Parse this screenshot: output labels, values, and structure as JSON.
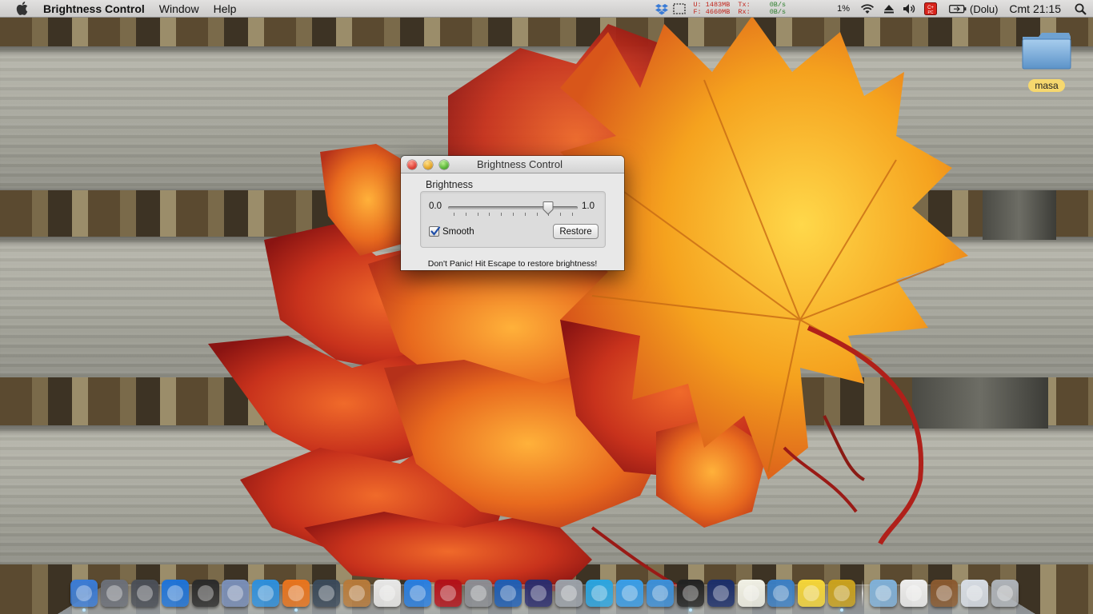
{
  "menubar": {
    "app_name": "Brightness Control",
    "menus": [
      "Window",
      "Help"
    ],
    "status": {
      "mem_used": "U: 1483MB",
      "mem_free": "F: 4660MB",
      "tx_label": "Tx:",
      "rx_label": "Rx:",
      "tx_rate": "0B/s",
      "rx_rate": "0B/s",
      "cpu": "1%",
      "battery": "(Dolu)",
      "clock": "Cmt 21:15"
    }
  },
  "desktop": {
    "folder_label": "masa"
  },
  "window": {
    "title": "Brightness Control",
    "group_label": "Brightness",
    "slider_min": "0.0",
    "slider_max": "1.0",
    "slider_value": 0.8,
    "smooth_label": "Smooth",
    "smooth_checked": true,
    "restore_label": "Restore",
    "hint": "Don't Panic!  Hit Escape to restore brightness!"
  },
  "dock": {
    "items": [
      {
        "name": "finder",
        "icon": "finder-icon",
        "color": "#3a7bd5",
        "running": true
      },
      {
        "name": "launchpad",
        "icon": "rocket-icon",
        "color": "#6b6f78",
        "running": false
      },
      {
        "name": "mission-control",
        "icon": "mission-control-icon",
        "color": "#4b4f57",
        "running": false
      },
      {
        "name": "app-store",
        "icon": "app-store-icon",
        "color": "#1e73d8",
        "running": false
      },
      {
        "name": "dashboard",
        "icon": "dashboard-icon",
        "color": "#2b2b2b",
        "running": false
      },
      {
        "name": "mail-stamp",
        "icon": "stamp-icon",
        "color": "#7a8fb8",
        "running": false
      },
      {
        "name": "safari",
        "icon": "compass-icon",
        "color": "#2e8fdc",
        "running": false
      },
      {
        "name": "firefox",
        "icon": "firefox-icon",
        "color": "#e8741e",
        "running": true
      },
      {
        "name": "camera",
        "icon": "camera-icon",
        "color": "#3b4a5a",
        "running": false
      },
      {
        "name": "address-book",
        "icon": "address-book-icon",
        "color": "#b77a3a",
        "running": false
      },
      {
        "name": "calendar",
        "icon": "calendar-icon",
        "color": "#e8e8e8",
        "running": false
      },
      {
        "name": "itunes",
        "icon": "music-icon",
        "color": "#2a7fe0",
        "running": false
      },
      {
        "name": "photo-booth",
        "icon": "photo-booth-icon",
        "color": "#b3121a",
        "running": false
      },
      {
        "name": "system-preferences",
        "icon": "gear-icon",
        "color": "#8a8d93",
        "running": false
      },
      {
        "name": "quicktime",
        "icon": "play-icon",
        "color": "#1f5fb5",
        "running": false
      },
      {
        "name": "imovie",
        "icon": "movie-icon",
        "color": "#2b2d6e",
        "running": false
      },
      {
        "name": "utility",
        "icon": "utility-icon",
        "color": "#9aa0a8",
        "running": false
      },
      {
        "name": "twitter",
        "icon": "bird-icon",
        "color": "#2ba5e0",
        "running": false
      },
      {
        "name": "ichat",
        "icon": "chat-bubble-icon",
        "color": "#3a9ee8",
        "running": false
      },
      {
        "name": "messenger",
        "icon": "people-icon",
        "color": "#3c8fd8",
        "running": false
      },
      {
        "name": "terminal",
        "icon": "terminal-icon",
        "color": "#222222",
        "running": true
      },
      {
        "name": "evo-dsdt",
        "icon": "evo-icon",
        "color": "#1c2f6b",
        "running": false
      },
      {
        "name": "textedit",
        "icon": "document-icon",
        "color": "#f1f1e6",
        "running": false
      },
      {
        "name": "sync",
        "icon": "sync-icon",
        "color": "#3b7fc4",
        "running": false
      },
      {
        "name": "stickies",
        "icon": "sticky-note-icon",
        "color": "#f5d63a",
        "running": false
      },
      {
        "name": "brightness",
        "icon": "sun-icon",
        "color": "#caa21e",
        "running": true
      }
    ],
    "right_items": [
      {
        "name": "applications-folder",
        "icon": "folder-icon",
        "color": "#7fb0d8"
      },
      {
        "name": "archive-zip",
        "icon": "zip-icon",
        "color": "#eeeeee"
      },
      {
        "name": "downloads",
        "icon": "box-icon",
        "color": "#8a5a30"
      },
      {
        "name": "utilities-stack",
        "icon": "stack-icon",
        "color": "#d6dce4"
      },
      {
        "name": "trash",
        "icon": "trash-icon",
        "color": "#aeb3b9"
      }
    ]
  }
}
